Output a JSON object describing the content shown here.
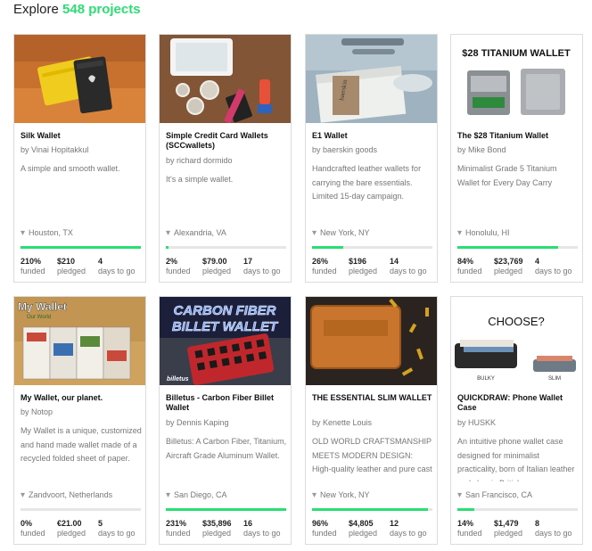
{
  "header": {
    "prefix": "Explore",
    "count": "548 projects"
  },
  "projects": [
    {
      "title": "Silk Wallet",
      "author": "by Vinai Hopitakkul",
      "blurb": "A simple and smooth wallet.",
      "location": "Houston, TX",
      "progress": 1.0,
      "funded": "210%",
      "pledged": "$210",
      "days": "4",
      "funded_label": "funded",
      "pledged_label": "pledged",
      "days_label": "days to go",
      "image": "silk-wallet-photo"
    },
    {
      "title": "Simple Credit Card Wallets (SCCwallets)",
      "author": "by richard dormido",
      "blurb": "It's a simple wallet.",
      "location": "Alexandria, VA",
      "progress": 0.02,
      "funded": "2%",
      "pledged": "$79.00",
      "days": "17",
      "funded_label": "funded",
      "pledged_label": "pledged",
      "days_label": "days to go",
      "image": "credit-card-wallet-photo"
    },
    {
      "title": "E1 Wallet",
      "author": "by baerskin goods",
      "blurb": "Handcrafted leather wallets for carrying the bare essentials. Limited 15-day campaign.",
      "location": "New York, NY",
      "progress": 0.26,
      "funded": "26%",
      "pledged": "$196",
      "days": "14",
      "funded_label": "funded",
      "pledged_label": "pledged",
      "days_label": "days to go",
      "image": "e1-wallet-photo"
    },
    {
      "title": "The $28 Titanium Wallet",
      "author": "by Mike Bond",
      "blurb": "Minimalist Grade 5 Titanium Wallet for Every Day Carry",
      "location": "Honolulu, HI",
      "progress": 0.84,
      "funded": "84%",
      "pledged": "$23,769",
      "days": "4",
      "funded_label": "funded",
      "pledged_label": "pledged",
      "days_label": "days to go",
      "image": "titanium-wallet-photo",
      "image_text": "$28 TITANIUM WALLET"
    },
    {
      "title": "My Wallet, our planet.",
      "author": "by Notop",
      "blurb": "My Wallet is a unique, customized and hand made wallet made of a recycled folded sheet of paper.",
      "location": "Zandvoort, Netherlands",
      "progress": 0.0,
      "funded": "0%",
      "pledged": "€21.00",
      "days": "5",
      "funded_label": "funded",
      "pledged_label": "pledged",
      "days_label": "days to go",
      "image": "paper-wallet-photo",
      "image_text": "My Wallet",
      "image_subtext": "Our World"
    },
    {
      "title": "Billetus - Carbon Fiber Billet Wallet",
      "author": "by Dennis Kaping",
      "blurb": "Billetus: A Carbon Fiber, Titanium, Aircraft Grade Aluminum Wallet.",
      "location": "San Diego, CA",
      "progress": 1.0,
      "funded": "231%",
      "pledged": "$35,896",
      "days": "16",
      "funded_label": "funded",
      "pledged_label": "pledged",
      "days_label": "days to go",
      "image": "carbon-fiber-wallet-photo",
      "image_text": "CARBON FIBER",
      "image_text2": "BILLET WALLET",
      "image_brand": "billetus"
    },
    {
      "title": "THE ESSENTIAL SLIM WALLET",
      "author": "by Kenette Louis",
      "blurb": "OLD WORLD CRAFTSMANSHIP MEETS MODERN DESIGN: High-quality leather and pure cast",
      "location": "New York, NY",
      "progress": 0.96,
      "funded": "96%",
      "pledged": "$4,805",
      "days": "12",
      "funded_label": "funded",
      "pledged_label": "pledged",
      "days_label": "days to go",
      "image": "slim-leather-wallet-photo"
    },
    {
      "title": "QUICKDRAW: Phone Wallet Case",
      "author": "by HUSKK",
      "blurb": "An intuitive phone wallet case designed for minimalist practicality, born of Italian leather and classic British",
      "location": "San Francisco, CA",
      "progress": 0.14,
      "funded": "14%",
      "pledged": "$1,479",
      "days": "8",
      "funded_label": "funded",
      "pledged_label": "pledged",
      "days_label": "days to go",
      "image": "quickdraw-wallet-photo",
      "image_text": "CHOOSE?",
      "image_label_a": "BULKY",
      "image_label_b": "SLIM"
    }
  ],
  "colors": {
    "accent": "#2bde73",
    "track": "#e6e6e6",
    "muted": "#777777"
  },
  "icons": {
    "location": "map-pin-icon"
  }
}
